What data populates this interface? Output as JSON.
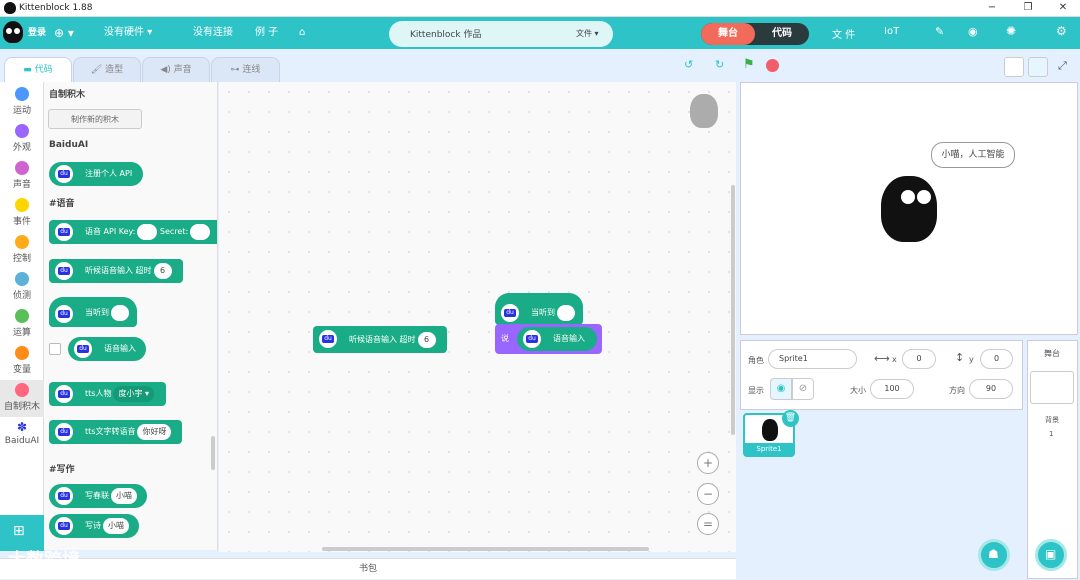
{
  "titlebar": {
    "title": "Kittenblock 1.88",
    "min": "−",
    "max": "❐",
    "close": "✕"
  },
  "menu": {
    "login": "登录",
    "globe": "⊕ ▾",
    "hardware": "没有硬件",
    "hardware_arrow": "▾",
    "connect": "没有连接",
    "examples": "例 子",
    "project_name": "Kittenblock 作品",
    "file_dd": "文件 ▾",
    "stage": "舞台",
    "code": "代码",
    "file": "文 件",
    "iot": "IoT"
  },
  "tabs": {
    "code": "代码",
    "costume": "造型",
    "sound": "声音",
    "connect": "连线"
  },
  "categories": [
    {
      "label": "运动",
      "color": "#4c97ff"
    },
    {
      "label": "外观",
      "color": "#9966ff"
    },
    {
      "label": "声音",
      "color": "#cf63cf"
    },
    {
      "label": "事件",
      "color": "#ffd500"
    },
    {
      "label": "控制",
      "color": "#ffab19"
    },
    {
      "label": "侦测",
      "color": "#5cb1d6"
    },
    {
      "label": "运算",
      "color": "#59c059"
    },
    {
      "label": "变量",
      "color": "#ff8c1a"
    },
    {
      "label": "自制积木",
      "color": "#ff6680"
    },
    {
      "label": "BaiduAI",
      "color": "#2932e1"
    }
  ],
  "flyout": {
    "custom_header": "自制积木",
    "make_block": "制作新的积木",
    "baidu_header": "BaiduAI",
    "register_api": "注册个人 API",
    "speech_header": "#语音",
    "api_key_label": "语音 API Key:",
    "secret_label": "Secret:",
    "listen_timeout": "听候语音输入 超时",
    "listen_value": "6",
    "when_heard": "当听到",
    "speech_input": "语音输入",
    "tts_person": "tts人物",
    "tts_person_value": "度小宇 ▾",
    "tts_text": "tts文字转语音",
    "tts_text_value": "你好呀",
    "write_header": "#写作",
    "couplet": "写春联",
    "couplet_value": "小喵",
    "poem": "写诗",
    "poem_value": "小喵"
  },
  "workspace": {
    "block1_label": "听候语音输入 超时",
    "block1_value": "6",
    "hat_label": "当听到",
    "say_label": "说",
    "say_inner": "语音输入",
    "zoom_in": "+",
    "zoom_out": "−",
    "zoom_reset": "="
  },
  "backpack": "书包",
  "stage": {
    "bubble": "小喵，人工智能"
  },
  "sprite_info": {
    "sprite_label": "角色",
    "sprite_name": "Sprite1",
    "x_label": "x",
    "x": "0",
    "y_label": "y",
    "y": "0",
    "show_label": "显示",
    "size_label": "大小",
    "size": "100",
    "dir_label": "方向",
    "dir": "90"
  },
  "sprites": [
    {
      "name": "Sprite1"
    }
  ],
  "stage_panel": {
    "title": "舞台",
    "backdrop_label": "背景",
    "backdrop_count": "1"
  },
  "watermark": "大数跨境"
}
